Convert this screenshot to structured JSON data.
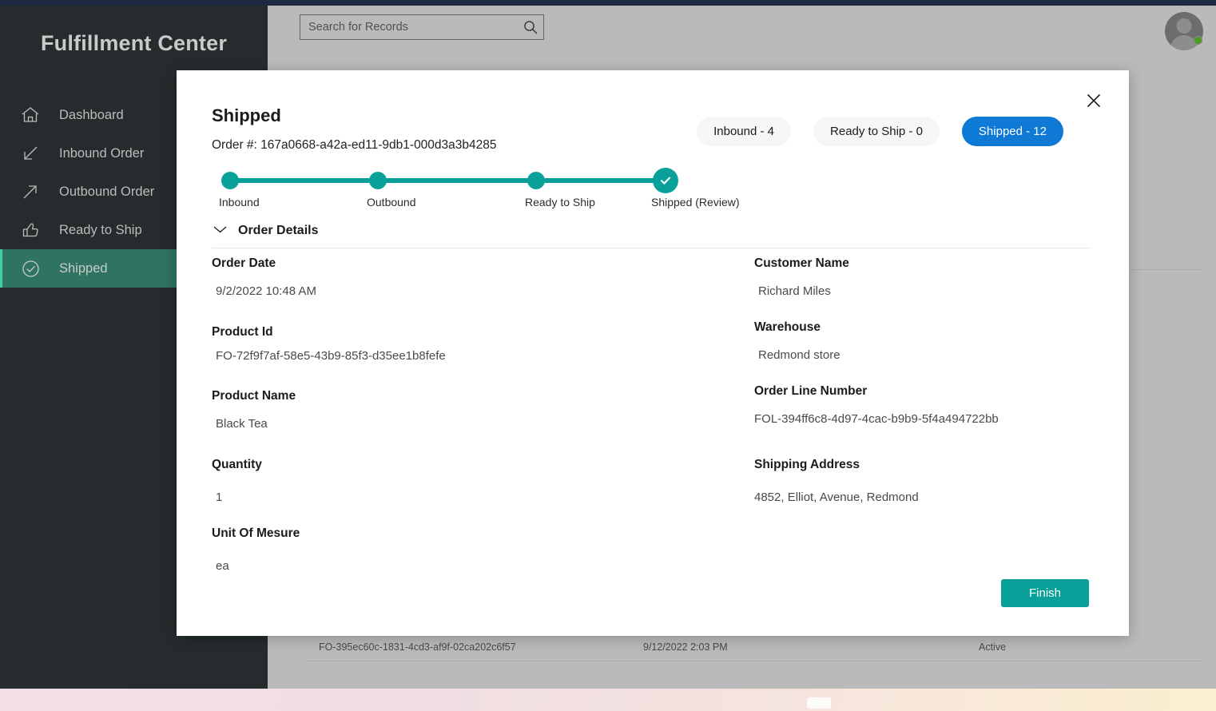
{
  "app": {
    "brand": "Fulfillment Center"
  },
  "search": {
    "placeholder": "Search for Records",
    "value": "",
    "icon": "search-icon"
  },
  "user": {
    "avatar": "user-avatar",
    "presence": "online"
  },
  "sidebar": {
    "items": [
      {
        "label": "Dashboard",
        "icon": "home-icon",
        "active": false
      },
      {
        "label": "Inbound Order",
        "icon": "arrow-down-left-icon",
        "active": false
      },
      {
        "label": "Outbound Order",
        "icon": "arrow-up-right-icon",
        "active": false
      },
      {
        "label": "Ready to Ship",
        "icon": "thumbs-up-icon",
        "active": false
      },
      {
        "label": "Shipped",
        "icon": "check-circle-icon",
        "active": true
      }
    ]
  },
  "background_table": {
    "rows": [
      {
        "id": "FO-395ec60c-1831-4cd3-af9f-02ca202c6f57",
        "date": "9/12/2022 2:03 PM",
        "status": "Active"
      }
    ]
  },
  "modal": {
    "title": "Shipped",
    "order_ref": "Order #: 167a0668-a42a-ed11-9db1-000d3a3b4285",
    "close_icon": "close-icon",
    "pills": [
      {
        "label": "Inbound - 4",
        "selected": false
      },
      {
        "label": "Ready to Ship - 0",
        "selected": false
      },
      {
        "label": "Shipped - 12",
        "selected": true
      }
    ],
    "stepper": {
      "steps": [
        {
          "label": "Inbound",
          "state": "complete"
        },
        {
          "label": "Outbound",
          "state": "complete"
        },
        {
          "label": "Ready to Ship",
          "state": "complete"
        },
        {
          "label": "Shipped (Review)",
          "state": "current"
        }
      ]
    },
    "details": {
      "toggle_label": "Order Details",
      "toggle_icon": "chevron-down-icon",
      "expanded": true,
      "left_fields": [
        {
          "label": "Order Date",
          "value": "9/2/2022 10:48 AM"
        },
        {
          "label": "Product Id",
          "value": "FO-72f9f7af-58e5-43b9-85f3-d35ee1b8fefe"
        },
        {
          "label": "Product Name",
          "value": "Black Tea"
        },
        {
          "label": "Quantity",
          "value": "1"
        },
        {
          "label": "Unit Of Mesure",
          "value": "ea"
        }
      ],
      "right_fields": [
        {
          "label": "Customer Name",
          "value": "Richard Miles"
        },
        {
          "label": "Warehouse",
          "value": "Redmond store"
        },
        {
          "label": "Order Line Number",
          "value": "FOL-394ff6c8-4d97-4cac-b9b9-5f4a494722bb"
        },
        {
          "label": "Shipping Address",
          "value": "4852, Elliot, Avenue, Redmond"
        }
      ]
    },
    "finish_label": "Finish"
  },
  "colors": {
    "teal": "#0aa09a",
    "sidebar_bg": "#262c2d",
    "sidebar_active": "#2f7361",
    "pill_selected": "#0f7ad6",
    "top_strip": "#1b2a41"
  }
}
